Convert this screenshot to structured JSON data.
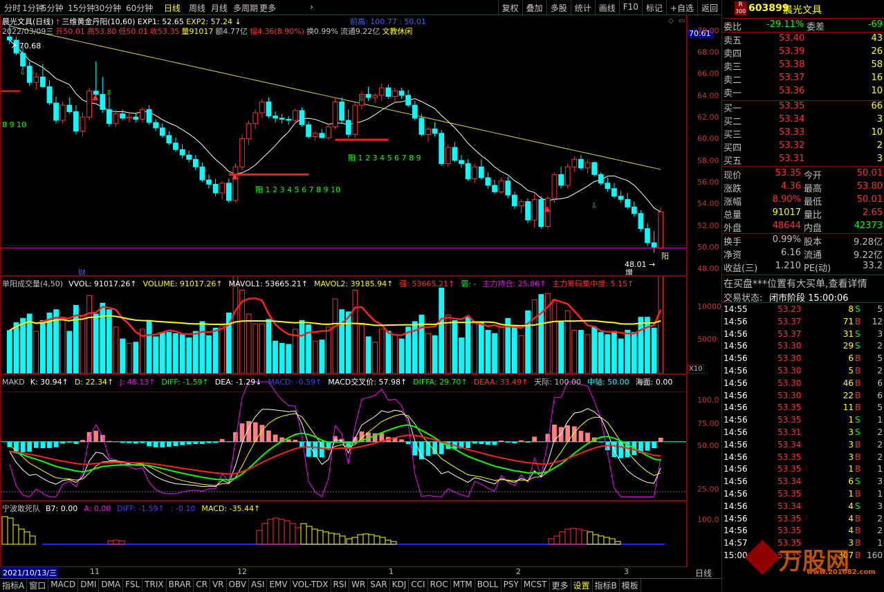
{
  "toolbar": {
    "periods": [
      "分时",
      "1分钟",
      "5分钟",
      "15分钟",
      "30分钟",
      "60分钟",
      "日线",
      "周线",
      "月线",
      "多周期",
      "更多"
    ],
    "active_period": "日线",
    "right_buttons": [
      "复权",
      "叠加",
      "多股",
      "统计",
      "画线",
      "F10",
      "标记",
      "+自选",
      "返回"
    ]
  },
  "main_chart": {
    "title": "晨光文具(日线)",
    "indicator": "三维黄金丹阳(10,60)",
    "exp1": "EXP1: 52.65",
    "exp2": "EXP2: 57.24",
    "prev_high": "前高: 100.77 : 50.01",
    "ohlc_line": [
      "2022/03/09三",
      "开50.01",
      "高53.80",
      "低50.01",
      "收53.35",
      "量91017",
      "额4.77亿",
      "幅4.36(8.90%)",
      "换0.99%",
      "流通9.22亿",
      "文教休闲"
    ],
    "label_high": "70.68",
    "label_low": "48.01",
    "label_top_axis": "70.61",
    "left_red_count": "8 9 10",
    "yang_label_1": "阳 1 2 3 4 5 6 7 8 9 10",
    "yang_label_2": "阳 1 2 3 4 5 6 7 8 9",
    "yang_label_3": "阳",
    "cai_label": "财",
    "zeng_label": "增",
    "y_ticks": [
      "70.00",
      "68.00",
      "66.00",
      "64.00",
      "62.00",
      "60.00",
      "58.00",
      "56.00",
      "54.00",
      "52.00",
      "50.00",
      "48.00"
    ]
  },
  "volume_panel": {
    "title": "单阳成交量(4,50)",
    "items": [
      {
        "text": "VVOL: 91017.26↑",
        "color": "#ffffff"
      },
      {
        "text": "VOLUME: 91017.26↑",
        "color": "#ffff00"
      },
      {
        "text": "MAVOL1: 53665.21↑",
        "color": "#ffffff"
      },
      {
        "text": "MAVOL2: 39185.94↑",
        "color": "#ffff00"
      },
      {
        "text": "强: 53665.21↑",
        "color": "#ff3030"
      },
      {
        "text": "弱: -",
        "color": "#00ff00"
      },
      {
        "text": "主力持仓: 25.86↑",
        "color": "#ff00ff"
      },
      {
        "text": "主力筹码集中度: 5.15↑",
        "color": "#ff3030"
      }
    ],
    "y_ticks": [
      "10000",
      "5000"
    ],
    "unit": "X10"
  },
  "makd_panel": {
    "title": "MAKD",
    "items": [
      {
        "text": "K: 30.94↑",
        "color": "#ffffff"
      },
      {
        "text": "D: 22.34↑",
        "color": "#ffff00"
      },
      {
        "text": "J: 48.13↑",
        "color": "#ff00ff"
      },
      {
        "text": "DIFF: -1.59↑",
        "color": "#00ff00"
      },
      {
        "text": "DEA: -1.29↓",
        "color": "#ffffff"
      },
      {
        "text": "MACD: -0.59↑",
        "color": "#4040ff"
      },
      {
        "text": "MACD交叉价: 57.98↑",
        "color": "#ffffff"
      },
      {
        "text": "DIFFA: 29.70↑",
        "color": "#00ff00"
      },
      {
        "text": "DEAA: 33.49↑",
        "color": "#ff3030"
      },
      {
        "text": "天际: 100.00",
        "color": "#c0c0c0"
      },
      {
        "text": "中轴: 50.00",
        "color": "#00ffff"
      },
      {
        "text": "海面: 0.00",
        "color": "#ffffff"
      }
    ],
    "y_ticks": [
      "100.0",
      "75.00",
      "50.00",
      "25.00"
    ]
  },
  "nb_panel": {
    "title": "宁波敢死队",
    "items": [
      {
        "text": "B7: 0.00",
        "color": "#ffffff"
      },
      {
        "text": "A: 0.00",
        "color": "#ff00ff"
      },
      {
        "text": "DIFF: -1.59↑",
        "color": "#4040ff"
      },
      {
        "text": ": -0.10",
        "color": "#4040ff"
      },
      {
        "text": "MACD: -35.44↑",
        "color": "#ffff00"
      }
    ],
    "y_ticks": [
      "100.0"
    ]
  },
  "date_axis": {
    "start": "2021/10/13/三",
    "months": [
      "11",
      "12",
      "1",
      "2",
      "3"
    ],
    "period_label": "日线"
  },
  "bottom_tabs": [
    "指标A",
    "窗口",
    "MACD",
    "DMI",
    "DMA",
    "FSL",
    "TRIX",
    "BRAR",
    "CR",
    "VR",
    "OBV",
    "ASI",
    "EMV",
    "VOL-TDX",
    "RSI",
    "WR",
    "SAR",
    "KDJ",
    "CCI",
    "ROC",
    "MTM",
    "BOLL",
    "PSY",
    "MCST",
    "更多",
    "设置",
    "指标B",
    "模板"
  ],
  "quote": {
    "code": "603899",
    "name": "晨光文具",
    "badge_top": "R",
    "badge_bottom": "300",
    "weibi_label": "委比",
    "weibi": "-29.11%",
    "weicha_label": "委差",
    "weicha": "-69",
    "asks": [
      {
        "label": "卖五",
        "price": "53.40",
        "vol": "43"
      },
      {
        "label": "卖四",
        "price": "53.39",
        "vol": "26"
      },
      {
        "label": "卖三",
        "price": "53.38",
        "vol": "58"
      },
      {
        "label": "卖二",
        "price": "53.37",
        "vol": "16"
      },
      {
        "label": "卖一",
        "price": "53.36",
        "vol": "10"
      }
    ],
    "bids": [
      {
        "label": "买一",
        "price": "53.35",
        "vol": "66"
      },
      {
        "label": "买二",
        "price": "53.34",
        "vol": "3"
      },
      {
        "label": "买三",
        "price": "53.33",
        "vol": "10"
      },
      {
        "label": "买四",
        "price": "53.32",
        "vol": "2"
      },
      {
        "label": "买五",
        "price": "53.31",
        "vol": "3"
      }
    ],
    "stats1": [
      {
        "l1": "现价",
        "v1": "53.35",
        "c1": "#ff3030",
        "l2": "今开",
        "v2": "50.01",
        "c2": "#ff3030"
      },
      {
        "l1": "涨跌",
        "v1": "4.36",
        "c1": "#ff3030",
        "l2": "最高",
        "v2": "53.80",
        "c2": "#ff3030"
      },
      {
        "l1": "涨幅",
        "v1": "8.90%",
        "c1": "#ff3030",
        "l2": "最低",
        "v2": "50.01",
        "c2": "#ff3030"
      },
      {
        "l1": "总量",
        "v1": "91017",
        "c1": "#ffff00",
        "l2": "量比",
        "v2": "2.65",
        "c2": "#ff3030"
      },
      {
        "l1": "外盘",
        "v1": "48644",
        "c1": "#ff3030",
        "l2": "内盘",
        "v2": "42373",
        "c2": "#00ff00"
      }
    ],
    "stats2": [
      {
        "l1": "换手",
        "v1": "0.99%",
        "c1": "#c0c0c0",
        "l2": "股本",
        "v2": "9.28亿",
        "c2": "#c0c0c0"
      },
      {
        "l1": "净资",
        "v1": "6.16",
        "c1": "#c0c0c0",
        "l2": "流通",
        "v2": "9.22亿",
        "c2": "#c0c0c0"
      },
      {
        "l1": "收益(三)",
        "v1": "1.210",
        "c1": "#c0c0c0",
        "l2": "PE(动)",
        "v2": "33.2",
        "c2": "#c0c0c0"
      }
    ],
    "notice": "在买盘***位置有大买单,查看详情",
    "status_label": "交易状态:",
    "status": "闭市阶段 15:00:06",
    "ticks": [
      {
        "t": "14:55",
        "p": "53.23",
        "v": "8",
        "s": "S",
        "n": "5"
      },
      {
        "t": "14:56",
        "p": "53.37",
        "v": "71",
        "s": "B",
        "n": "12"
      },
      {
        "t": "14:56",
        "p": "53.37",
        "v": "31",
        "s": "S",
        "n": "3"
      },
      {
        "t": "14:56",
        "p": "53.30",
        "v": "29",
        "s": "S",
        "n": "2"
      },
      {
        "t": "14:56",
        "p": "53.30",
        "v": "6",
        "s": "B",
        "n": "5"
      },
      {
        "t": "14:56",
        "p": "53.30",
        "v": "5",
        "s": "B",
        "n": "2"
      },
      {
        "t": "14:56",
        "p": "53.30",
        "v": "46",
        "s": "B",
        "n": "6"
      },
      {
        "t": "14:56",
        "p": "53.30",
        "v": "22",
        "s": "B",
        "n": "6"
      },
      {
        "t": "14:56",
        "p": "53.35",
        "v": "11",
        "s": "B",
        "n": "5"
      },
      {
        "t": "14:56",
        "p": "53.35",
        "v": "1",
        "s": "S",
        "n": "1"
      },
      {
        "t": "14:56",
        "p": "53.31",
        "v": "3",
        "s": "S",
        "n": "2"
      },
      {
        "t": "14:56",
        "p": "53.34",
        "v": "3",
        "s": "B",
        "n": "2"
      },
      {
        "t": "14:56",
        "p": "53.35",
        "v": "3",
        "s": "B",
        "n": "2"
      },
      {
        "t": "14:56",
        "p": "53.35",
        "v": "1",
        "s": "B",
        "n": "1"
      },
      {
        "t": "14:56",
        "p": "53.34",
        "v": "6",
        "s": "S",
        "n": "3"
      },
      {
        "t": "14:56",
        "p": "53.35",
        "v": "1",
        "s": "B",
        "n": "1"
      },
      {
        "t": "14:56",
        "p": "53.34",
        "v": "4",
        "s": "S",
        "n": "3"
      },
      {
        "t": "14:56",
        "p": "53.35",
        "v": "4",
        "s": "B",
        "n": "2"
      },
      {
        "t": "14:56",
        "p": "53.35",
        "v": "4",
        "s": "B",
        "n": "2"
      },
      {
        "t": "14:57",
        "p": "53.35",
        "v": "3",
        "s": "B",
        "n": "1"
      },
      {
        "t": "15:00",
        "p": "53.35",
        "v": "307",
        "s": "B",
        "n": "160"
      }
    ],
    "watermark": "万股网",
    "watermark_url": "www.201082.com"
  },
  "colors": {
    "up": "#ff3030",
    "down": "#00ffff",
    "border": "#8b0000",
    "yellow": "#ffff00"
  },
  "chart_data": {
    "type": "candlestick",
    "ohlc": [
      [
        69.5,
        70.68,
        68.8,
        69.2
      ],
      [
        69.2,
        69.5,
        67.8,
        68.0
      ],
      [
        68.0,
        68.6,
        66.5,
        66.8
      ],
      [
        66.8,
        67.2,
        65.0,
        65.3
      ],
      [
        65.3,
        66.2,
        64.6,
        65.8
      ],
      [
        65.8,
        67.0,
        64.8,
        64.9
      ],
      [
        64.9,
        65.5,
        63.2,
        63.4
      ],
      [
        63.4,
        64.0,
        61.5,
        61.8
      ],
      [
        61.8,
        63.5,
        61.5,
        63.2
      ],
      [
        63.2,
        63.9,
        62.4,
        62.6
      ],
      [
        62.6,
        63.2,
        60.5,
        60.8
      ],
      [
        60.8,
        62.5,
        60.3,
        62.1
      ],
      [
        62.1,
        64.8,
        61.8,
        64.5
      ],
      [
        64.5,
        67.2,
        63.8,
        64.2
      ],
      [
        64.2,
        65.8,
        62.5,
        62.8
      ],
      [
        62.8,
        64.0,
        61.2,
        61.5
      ],
      [
        61.5,
        62.8,
        61.2,
        62.4
      ],
      [
        62.4,
        62.8,
        61.8,
        62.0
      ],
      [
        62.0,
        62.5,
        61.6,
        62.1
      ],
      [
        62.1,
        62.5,
        61.6,
        61.9
      ],
      [
        61.9,
        63.0,
        61.6,
        62.8
      ],
      [
        62.8,
        63.2,
        61.4,
        61.6
      ],
      [
        61.6,
        61.9,
        60.8,
        61.1
      ],
      [
        61.1,
        61.5,
        60.2,
        60.4
      ],
      [
        60.4,
        60.8,
        59.5,
        59.7
      ],
      [
        59.7,
        60.2,
        58.9,
        59.1
      ],
      [
        59.1,
        59.6,
        58.3,
        58.6
      ],
      [
        58.6,
        59.0,
        57.9,
        58.2
      ],
      [
        58.2,
        58.6,
        57.2,
        57.5
      ],
      [
        57.5,
        57.9,
        56.1,
        56.3
      ],
      [
        56.3,
        56.8,
        55.5,
        55.9
      ],
      [
        55.9,
        56.4,
        54.8,
        55.1
      ],
      [
        55.1,
        56.2,
        54.5,
        56.0
      ],
      [
        56.0,
        56.4,
        54.2,
        54.4
      ],
      [
        54.4,
        57.8,
        54.2,
        57.5
      ],
      [
        57.5,
        60.5,
        57.2,
        60.1
      ],
      [
        60.1,
        61.8,
        59.5,
        61.5
      ],
      [
        61.5,
        62.8,
        61.0,
        62.5
      ],
      [
        62.5,
        63.8,
        62.0,
        63.5
      ],
      [
        63.5,
        63.9,
        62.0,
        62.2
      ],
      [
        62.2,
        62.6,
        61.6,
        62.0
      ],
      [
        62.0,
        62.4,
        61.5,
        61.9
      ],
      [
        61.9,
        62.2,
        61.4,
        61.8
      ],
      [
        61.8,
        62.9,
        61.5,
        62.7
      ],
      [
        62.7,
        63.0,
        61.2,
        61.4
      ],
      [
        61.4,
        61.7,
        60.1,
        60.3
      ],
      [
        60.3,
        60.8,
        59.9,
        60.6
      ],
      [
        60.6,
        61.0,
        60.1,
        60.2
      ],
      [
        60.2,
        61.5,
        60.0,
        61.2
      ],
      [
        61.2,
        63.8,
        61.0,
        63.5
      ],
      [
        63.5,
        63.9,
        61.5,
        61.8
      ],
      [
        61.8,
        62.8,
        60.2,
        60.5
      ],
      [
        60.5,
        63.4,
        60.2,
        63.2
      ],
      [
        63.2,
        64.5,
        62.8,
        64.2
      ],
      [
        64.2,
        64.9,
        63.6,
        63.9
      ],
      [
        63.9,
        64.3,
        63.4,
        64.1
      ],
      [
        64.1,
        65.2,
        63.6,
        64.8
      ],
      [
        64.8,
        65.1,
        63.8,
        64.0
      ],
      [
        64.0,
        64.8,
        63.5,
        64.5
      ],
      [
        64.5,
        64.8,
        63.8,
        64.1
      ],
      [
        64.1,
        64.6,
        63.0,
        63.2
      ],
      [
        63.2,
        63.6,
        61.8,
        62.0
      ],
      [
        62.0,
        62.4,
        60.3,
        60.5
      ],
      [
        60.5,
        61.2,
        59.8,
        61.0
      ],
      [
        61.0,
        61.6,
        60.3,
        60.6
      ],
      [
        60.6,
        60.9,
        57.6,
        57.8
      ],
      [
        57.8,
        59.6,
        57.5,
        59.3
      ],
      [
        59.3,
        59.8,
        57.9,
        58.1
      ],
      [
        58.1,
        58.6,
        57.4,
        57.8
      ],
      [
        57.8,
        58.2,
        56.2,
        56.4
      ],
      [
        56.4,
        57.8,
        56.0,
        57.5
      ],
      [
        57.5,
        58.2,
        56.3,
        56.5
      ],
      [
        56.5,
        57.0,
        55.5,
        55.8
      ],
      [
        55.8,
        56.3,
        55.0,
        55.2
      ],
      [
        55.2,
        56.5,
        55.0,
        56.2
      ],
      [
        56.2,
        56.6,
        54.6,
        54.9
      ],
      [
        54.9,
        55.2,
        53.6,
        53.9
      ],
      [
        53.9,
        54.5,
        53.2,
        54.3
      ],
      [
        54.3,
        54.6,
        52.3,
        52.6
      ],
      [
        52.6,
        55.0,
        51.9,
        54.5
      ],
      [
        54.5,
        54.8,
        51.8,
        52.0
      ],
      [
        52.0,
        54.8,
        51.8,
        54.6
      ],
      [
        54.6,
        57.0,
        54.2,
        56.8
      ],
      [
        56.8,
        57.5,
        55.5,
        55.8
      ],
      [
        55.8,
        57.8,
        55.5,
        57.5
      ],
      [
        57.5,
        58.5,
        57.0,
        58.2
      ],
      [
        58.2,
        58.6,
        57.2,
        57.4
      ],
      [
        57.4,
        58.2,
        56.9,
        57.9
      ],
      [
        57.9,
        58.0,
        56.6,
        56.8
      ],
      [
        56.8,
        57.0,
        55.8,
        56.0
      ],
      [
        56.0,
        56.5,
        55.2,
        55.5
      ],
      [
        55.5,
        56.0,
        54.6,
        54.8
      ],
      [
        54.8,
        55.3,
        54.2,
        54.5
      ],
      [
        54.5,
        55.1,
        53.6,
        53.8
      ],
      [
        53.8,
        54.3,
        52.9,
        53.2
      ],
      [
        53.2,
        53.5,
        51.5,
        51.8
      ],
      [
        51.8,
        52.3,
        50.2,
        50.5
      ],
      [
        50.5,
        51.6,
        49.6,
        50.1
      ],
      [
        50.01,
        53.8,
        50.01,
        53.35
      ]
    ],
    "yrange": [
      47.5,
      71.5
    ],
    "xlabel": "",
    "ylabel": ""
  }
}
